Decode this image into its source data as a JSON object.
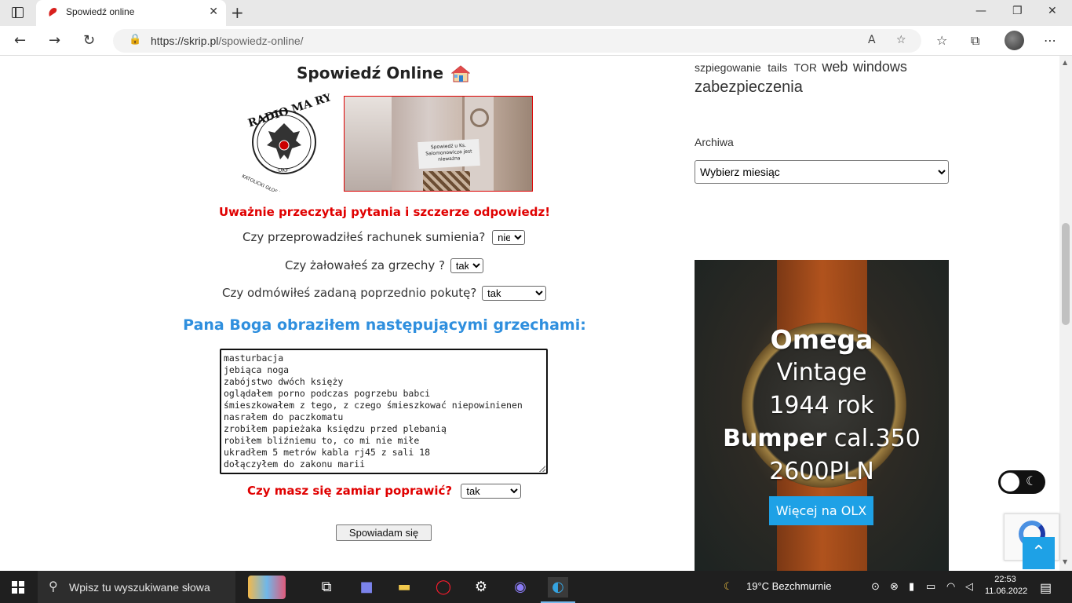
{
  "browser": {
    "tab_title": "Spowiedź online",
    "url_host": "https://skrip.pl",
    "url_path": "/spowiedz-online/"
  },
  "page": {
    "title": "Spowiedź Online",
    "logo_text": [
      "RADIO MA RYJA",
      "KATOLICKI GŁOS W TWOIM DOMU",
      "UKF"
    ],
    "photo_sign": "Spowiedź u Ks. Salomonowicza jest nieważna",
    "warning": "Uważnie przeczytaj pytania i szczerze odpowiedz!",
    "questions": [
      {
        "label": "Czy przeprowadziłeś rachunek sumienia?",
        "value": "nie"
      },
      {
        "label": "Czy żałowałeś za grzechy ?",
        "value": "tak"
      },
      {
        "label": "Czy odmówiłeś zadaną poprzednio pokutę?",
        "value": "tak"
      }
    ],
    "sins_heading": "Pana Boga obraziłem następującymi grzechami:",
    "sins_lines": [
      "masturbacja",
      "jebiąca noga",
      "zabójstwo dwóch księży",
      "oglądałem porno podczas pogrzebu babci",
      "śmieszkowałem z tego, z czego śmieszkować niepowinienen",
      "nasrałem do paczkomatu",
      "zrobiłem papieżaka księdzu przed plebanią",
      "robiłem bliźniemu to, co mi nie miłe",
      "ukradłem 5 metrów kabla rj45 z sali 18",
      "dołączyłem do zakonu marii"
    ],
    "improve_label": "Czy masz się zamiar poprawić?",
    "improve_value": "tak",
    "submit_label": "Spowiadam się"
  },
  "sidebar": {
    "tags_line1": [
      "szpiegowanie",
      "tails",
      "TOR",
      "web",
      "windows"
    ],
    "tags_line2": [
      "zabezpieczenia"
    ],
    "archive_label": "Archiwa",
    "archive_select": "Wybierz miesiąc",
    "ad": {
      "line1": "Omega",
      "line2": "Vintage",
      "line3": "1944 rok",
      "line4_bold": "Bumper",
      "line4_rest": " cal.350",
      "line5": "2600PLN",
      "button": "Więcej na OLX"
    }
  },
  "taskbar": {
    "search_placeholder": "Wpisz tu wyszukiwane słowa",
    "weather": "19°C  Bezchmurnie",
    "time": "22:53",
    "date": "11.06.2022"
  }
}
